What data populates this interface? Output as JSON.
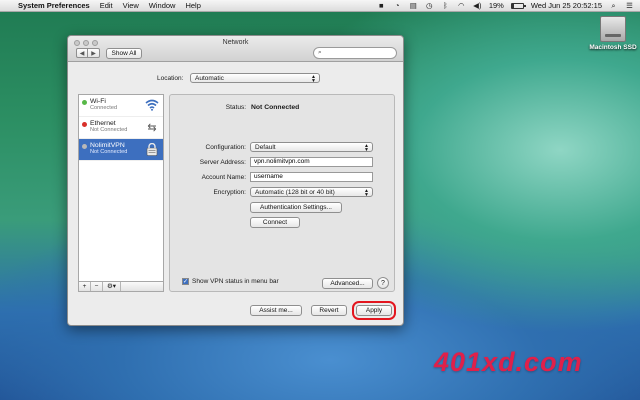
{
  "menubar": {
    "app_name": "System Preferences",
    "menus": [
      "Edit",
      "View",
      "Window",
      "Help"
    ],
    "battery_text": "19%",
    "battery_level": 0.19,
    "clock": "Wed Jun 25  20:52:15"
  },
  "desktop": {
    "disk_label": "Macintosh SSD"
  },
  "window": {
    "title": "Network",
    "show_all_label": "Show All",
    "search_placeholder": "",
    "location_label": "Location:",
    "location_value": "Automatic"
  },
  "services": [
    {
      "name": "Wi-Fi",
      "state": "Connected",
      "dot_color": "#58b848",
      "icon": "wifi-icon"
    },
    {
      "name": "Ethernet",
      "state": "Not Connected",
      "dot_color": "#d8302a",
      "icon": "ethernet-arrows-icon"
    },
    {
      "name": "NolimitVPN",
      "state": "Not Connected",
      "dot_color": "#b8b8b8",
      "icon": "vpn-lock-icon"
    }
  ],
  "sidebar_tools": {
    "add": "+",
    "remove": "−",
    "gear": "⚙▾"
  },
  "detail": {
    "status_label": "Status:",
    "status_value": "Not Connected",
    "configuration_label": "Configuration:",
    "configuration_value": "Default",
    "server_label": "Server Address:",
    "server_value": "vpn.nolimitvpn.com",
    "account_label": "Account Name:",
    "account_value": "username",
    "encryption_label": "Encryption:",
    "encryption_value": "Automatic (128 bit or 40 bit)",
    "auth_button": "Authentication Settings...",
    "connect_button": "Connect",
    "show_status_label": "Show VPN status in menu bar",
    "advanced_button": "Advanced...",
    "help_button": "?"
  },
  "footer": {
    "assist_button": "Assist me...",
    "revert_button": "Revert",
    "apply_button": "Apply",
    "highlight_color": "#e3161f"
  },
  "watermark": "401xd.com"
}
